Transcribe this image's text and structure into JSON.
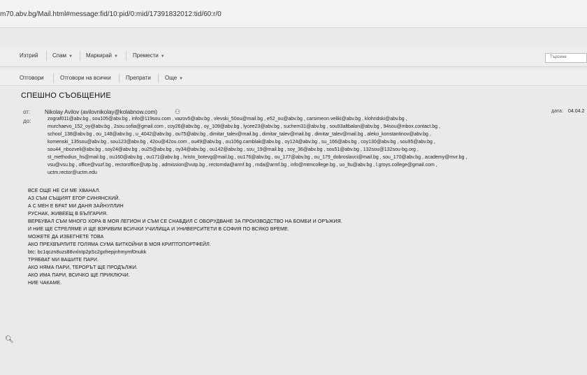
{
  "browser": {
    "url": "m70.abv.bg/Mail.html#message:fid/10:pid/0:mid/17391832012:tid/60:r/0"
  },
  "toolbar": {
    "delete": "Изтрий",
    "spam": "Спам",
    "mark": "Маркирай",
    "move": "Премести",
    "search_placeholder": "Търсене"
  },
  "actions": {
    "reply": "Отговори",
    "reply_all": "Отговори на всички",
    "forward": "Препрати",
    "more": "Още"
  },
  "message": {
    "subject": "СПЕШНО СЪОБЩЕНИЕ",
    "from_label": "от:",
    "from": "Nikolay Avilov (avilovnikolay@kolabnow.com)",
    "to_label": "до:",
    "date_label": "дата:",
    "date": "04.04.2",
    "recipients": [
      "zograf011@abv.bg , sou105@abv.bg , info@119sou.com , vazov5@abv.bg , vlevski_50ou@mail.bg , e52_ou@abv.bg , carsimeon.veliki@abv.bg , klohridski@abv.bg ,",
      "murchaevo_152_oy@abv.bg , 2sou.sofia@gmail.com , coy26@abv.bg , oy_109@abv.bg , lycee23@abv.bg , suchem31@abv.bg , sou93altbalan@abv.bg , 94sou@mbox.contact.bg ,",
      "school_138@abv.bg , ou_148@abv.bg , u_4042@abv.bg , ou75@abv.bg , dimitar_talev@mail.bg , dimitar_talev@mail.bg , dimitar_talev@mail.bg , aleko_konstantinov@abv.bg ,",
      "komenski_135sou@abv.bg , sou123@abv.bg , 42ou@42ou.com , ou49@abv.bg , ou106g.camblak@abv.bg , oy124@abv.bg , su_166@abv.bg , coy130@abv.bg , sou95@abv.bg ,",
      "sou44_nbozveli@abv.bg , soy24@abv.bg , ou25@abv.bg , oy34@abv.bg , ou142@abv.bg , sou_19@mail.bg , soy_36@abv.bg , sou51@abv.bg , 132sou@132sou-bg.org ,",
      "st_methodius_hs@mail.bg , ou160@abv.bg , ou171@abv.bg , hristo_botevg@mail.bg , ou176@abv.bg , ou_177@abv.bg , ou_179_dobroslavci@mail.bg , sou_170@abv.bg , academy@mvr.bg ,",
      "vsu@vsu.bg , office@vuzf.bg , rectoroffice@utp.bg , admission@vutp.bg , rectornda@armf.bg , rnda@armf.bg , info@mtmcollege.bg , uo_ltu@abv.bg , l.groys.college@gmail.com ,",
      "uctm.rector@uctm.edu"
    ],
    "body": [
      "ВСЕ ОЩЕ НЕ СИ МЕ ХВАНАЛ.",
      "АЗ СЪМ СЪЩИЯТ ЕГОР СИНЯНСКИЙ.",
      "А С МЕН Е БРАТ МИ ДАНЯ ЗАЙНУЛЛИН",
      "РУСНАК, ЖИВЕЕЩ В БЪЛГАРИЯ.",
      "ВЕРБУВАЛ СЪМ МНОГО ХОРА В МОЯ ЛЕГИОН И СЪМ СЕ СНАБДИЛ С ОБОРУДВАНЕ ЗА ПРОИЗВОДСТВО НА БОМБИ И ОРЪЖИЯ.",
      "И НИЕ ЩЕ СТРЕЛЯМЕ И ЩЕ ВЗРИВИМ ВСИЧКИ УЧИЛИЩА И УНИВЕРСИТЕТИ В СОФИЯ ПО ВСЯКО ВРЕМЕ.",
      "МОЖЕТЕ ДА ИЗБЕГНЕТЕ ТОВА",
      "АКО ПРЕХВЪРЛИТЕ ГОЛЯМА СУМА БИТКОЙНИ В МОЯ КРИПТОПОРТФЕЙЛ.",
      "btc: bc1qczn8uzs88vxlntp2pSc2gxfrepjnhmymf0nukk",
      "ТРЯБВАТ МИ ВАШИТЕ ПАРИ.",
      "АКО НЯМА ПАРИ, ТЕРОРЪТ ЩЕ ПРОДЪЛЖИ.",
      "АКО ИМА ПАРИ, ВСИЧКО ЩЕ ПРИКЛЮЧИ.",
      "НИЕ ЧАКАМЕ."
    ]
  }
}
